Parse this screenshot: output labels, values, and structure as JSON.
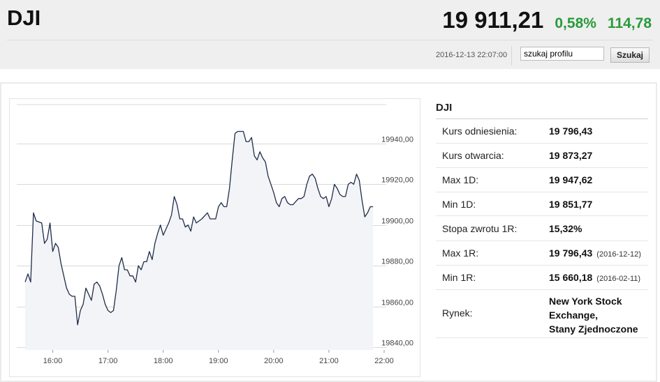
{
  "header": {
    "symbol": "DJI",
    "price": "19 911,21",
    "change_pct": "0,58%",
    "change_abs": "114,78",
    "timestamp": "2016-12-13 22:07:00",
    "search_placeholder": "szukaj profilu",
    "search_button": "Szukaj"
  },
  "colors": {
    "up": "#2a9a3c",
    "line": "#1f2d4a",
    "fill": "#f3f4f7",
    "grid": "#d9d9d9"
  },
  "info": {
    "title": "DJI",
    "rows": [
      {
        "label": "Kurs odniesienia:",
        "value": "19 796,43",
        "date": ""
      },
      {
        "label": "Kurs otwarcia:",
        "value": "19 873,27",
        "date": ""
      },
      {
        "label": "Max 1D:",
        "value": "19 947,62",
        "date": ""
      },
      {
        "label": "Min 1D:",
        "value": "19 851,77",
        "date": ""
      },
      {
        "label": "Stopa zwrotu 1R:",
        "value": "15,32%",
        "date": ""
      },
      {
        "label": "Max 1R:",
        "value": "19 796,43",
        "date": "(2016-12-12)"
      },
      {
        "label": "Min 1R:",
        "value": "15 660,18",
        "date": "(2016-02-11)"
      }
    ],
    "market_label": "Rynek:",
    "market_lines": [
      "New York Stock",
      "Exchange,",
      "Stany Zjednoczone"
    ]
  },
  "chart_data": {
    "type": "area",
    "y_ticks": [
      "19940,00",
      "19920,00",
      "19900,00",
      "19880,00",
      "19860,00",
      "19840,00"
    ],
    "y_tick_values": [
      19940,
      19920,
      19900,
      19880,
      19860,
      19840
    ],
    "x_ticks": [
      "16:00",
      "17:00",
      "18:00",
      "19:00",
      "20:00",
      "21:00",
      "22:00"
    ],
    "x_tick_values": [
      16,
      17,
      18,
      19,
      20,
      21,
      22
    ],
    "xlim": [
      15.5,
      22.05
    ],
    "ylim": [
      19838,
      19957
    ],
    "grid": true,
    "series": [
      {
        "values": [
          [
            15.5,
            19872
          ],
          [
            15.55,
            19876
          ],
          [
            15.6,
            19872
          ],
          [
            15.65,
            19906
          ],
          [
            15.7,
            19902
          ],
          [
            15.8,
            19901
          ],
          [
            15.85,
            19891
          ],
          [
            15.9,
            19893
          ],
          [
            15.95,
            19901
          ],
          [
            16.0,
            19887
          ],
          [
            16.05,
            19891
          ],
          [
            16.1,
            19889
          ],
          [
            16.15,
            19881
          ],
          [
            16.25,
            19869
          ],
          [
            16.3,
            19866
          ],
          [
            16.35,
            19865
          ],
          [
            16.4,
            19865
          ],
          [
            16.45,
            19851
          ],
          [
            16.5,
            19858
          ],
          [
            16.55,
            19861
          ],
          [
            16.6,
            19869
          ],
          [
            16.65,
            19866
          ],
          [
            16.7,
            19863
          ],
          [
            16.75,
            19871
          ],
          [
            16.8,
            19872
          ],
          [
            16.85,
            19870
          ],
          [
            16.9,
            19866
          ],
          [
            16.95,
            19861
          ],
          [
            17.0,
            19858
          ],
          [
            17.05,
            19857
          ],
          [
            17.1,
            19858
          ],
          [
            17.15,
            19868
          ],
          [
            17.2,
            19880
          ],
          [
            17.25,
            19884
          ],
          [
            17.3,
            19878
          ],
          [
            17.35,
            19878
          ],
          [
            17.4,
            19875
          ],
          [
            17.45,
            19875
          ],
          [
            17.5,
            19872
          ],
          [
            17.55,
            19880
          ],
          [
            17.6,
            19878
          ],
          [
            17.65,
            19882
          ],
          [
            17.7,
            19882
          ],
          [
            17.75,
            19887
          ],
          [
            17.8,
            19883
          ],
          [
            17.85,
            19891
          ],
          [
            17.9,
            19896
          ],
          [
            17.95,
            19900
          ],
          [
            18.0,
            19895
          ],
          [
            18.05,
            19898
          ],
          [
            18.1,
            19901
          ],
          [
            18.15,
            19905
          ],
          [
            18.2,
            19914
          ],
          [
            18.25,
            19910
          ],
          [
            18.3,
            19903
          ],
          [
            18.35,
            19903
          ],
          [
            18.4,
            19899
          ],
          [
            18.45,
            19900
          ],
          [
            18.5,
            19897
          ],
          [
            18.55,
            19904
          ],
          [
            18.6,
            19901
          ],
          [
            18.7,
            19903
          ],
          [
            18.8,
            19906
          ],
          [
            18.85,
            19903
          ],
          [
            18.9,
            19903
          ],
          [
            18.95,
            19903
          ],
          [
            19.0,
            19909
          ],
          [
            19.05,
            19911
          ],
          [
            19.1,
            19909
          ],
          [
            19.15,
            19909
          ],
          [
            19.2,
            19918
          ],
          [
            19.25,
            19932
          ],
          [
            19.3,
            19945
          ],
          [
            19.35,
            19946
          ],
          [
            19.45,
            19946
          ],
          [
            19.5,
            19941
          ],
          [
            19.55,
            19941
          ],
          [
            19.6,
            19943
          ],
          [
            19.65,
            19934
          ],
          [
            19.7,
            19932
          ],
          [
            19.75,
            19936
          ],
          [
            19.8,
            19933
          ],
          [
            19.85,
            19931
          ],
          [
            19.9,
            19924
          ],
          [
            19.95,
            19920
          ],
          [
            20.0,
            19916
          ],
          [
            20.05,
            19911
          ],
          [
            20.1,
            19909
          ],
          [
            20.15,
            19913
          ],
          [
            20.2,
            19914
          ],
          [
            20.25,
            19911
          ],
          [
            20.3,
            19910
          ],
          [
            20.35,
            19910
          ],
          [
            20.45,
            19913
          ],
          [
            20.5,
            19913
          ],
          [
            20.55,
            19914
          ],
          [
            20.6,
            19920
          ],
          [
            20.65,
            19924
          ],
          [
            20.7,
            19925
          ],
          [
            20.75,
            19923
          ],
          [
            20.8,
            19918
          ],
          [
            20.85,
            19914
          ],
          [
            20.9,
            19913
          ],
          [
            20.95,
            19914
          ],
          [
            21.0,
            19909
          ],
          [
            21.05,
            19913
          ],
          [
            21.1,
            19920
          ],
          [
            21.15,
            19918
          ],
          [
            21.2,
            19915
          ],
          [
            21.25,
            19914
          ],
          [
            21.3,
            19914
          ],
          [
            21.35,
            19920
          ],
          [
            21.4,
            19921
          ],
          [
            21.45,
            19920
          ],
          [
            21.5,
            19925
          ],
          [
            21.55,
            19922
          ],
          [
            21.6,
            19912
          ],
          [
            21.65,
            19904
          ],
          [
            21.7,
            19906
          ],
          [
            21.75,
            19909
          ],
          [
            21.8,
            19909
          ]
        ]
      }
    ]
  }
}
